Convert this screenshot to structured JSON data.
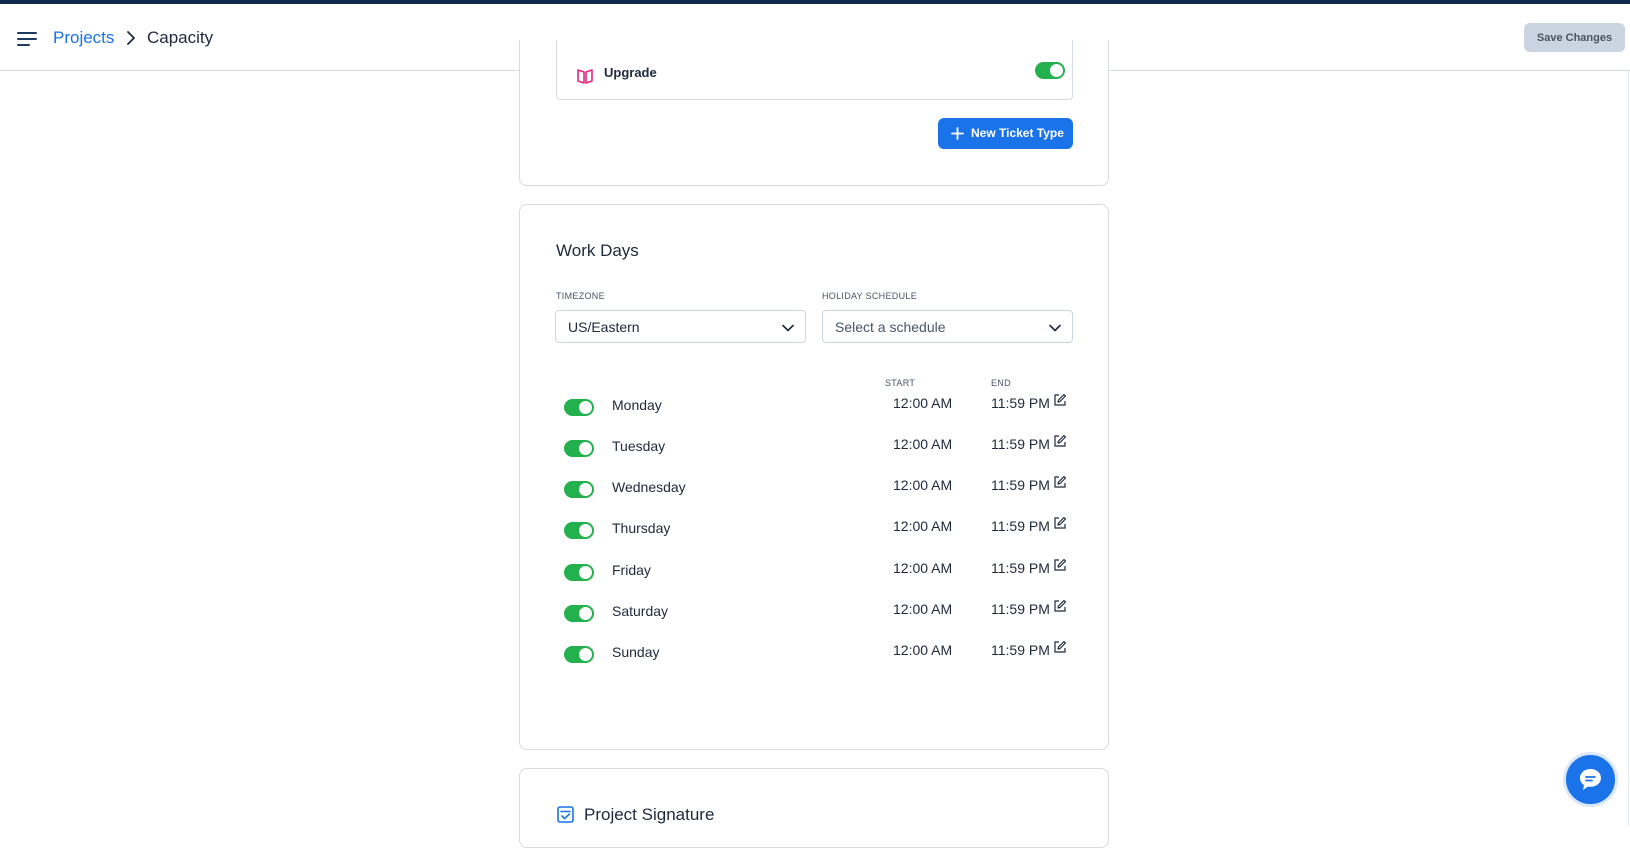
{
  "header": {
    "breadcrumb_root": "Projects",
    "breadcrumb_current": "Capacity",
    "save_label": "Save Changes"
  },
  "ticket_types": {
    "last_item_label": "Upgrade",
    "last_item_enabled": true,
    "new_button_label": "New Ticket Type"
  },
  "work_days": {
    "title": "Work Days",
    "timezone_label": "TIMEZONE",
    "timezone_value": "US/Eastern",
    "holiday_label": "HOLIDAY SCHEDULE",
    "holiday_placeholder": "Select a schedule",
    "start_header": "START",
    "end_header": "END",
    "days": [
      {
        "name": "Monday",
        "enabled": true,
        "start": "12:00 AM",
        "end": "11:59 PM"
      },
      {
        "name": "Tuesday",
        "enabled": true,
        "start": "12:00 AM",
        "end": "11:59 PM"
      },
      {
        "name": "Wednesday",
        "enabled": true,
        "start": "12:00 AM",
        "end": "11:59 PM"
      },
      {
        "name": "Thursday",
        "enabled": true,
        "start": "12:00 AM",
        "end": "11:59 PM"
      },
      {
        "name": "Friday",
        "enabled": true,
        "start": "12:00 AM",
        "end": "11:59 PM"
      },
      {
        "name": "Saturday",
        "enabled": true,
        "start": "12:00 AM",
        "end": "11:59 PM"
      },
      {
        "name": "Sunday",
        "enabled": true,
        "start": "12:00 AM",
        "end": "11:59 PM"
      }
    ]
  },
  "signature": {
    "title": "Project Signature"
  },
  "colors": {
    "accent": "#1a73e8",
    "toggle_on": "#22b14c",
    "upgrade_icon": "#e0267d"
  },
  "icons": {
    "menu": "hamburger-menu-icon",
    "breadcrumb_sep": "chevron-right-icon",
    "upgrade": "upgrade-icon",
    "plus": "plus-icon",
    "dropdown": "chevron-down-icon",
    "edit": "edit-icon",
    "signature": "signature-icon",
    "chat": "chat-icon"
  }
}
